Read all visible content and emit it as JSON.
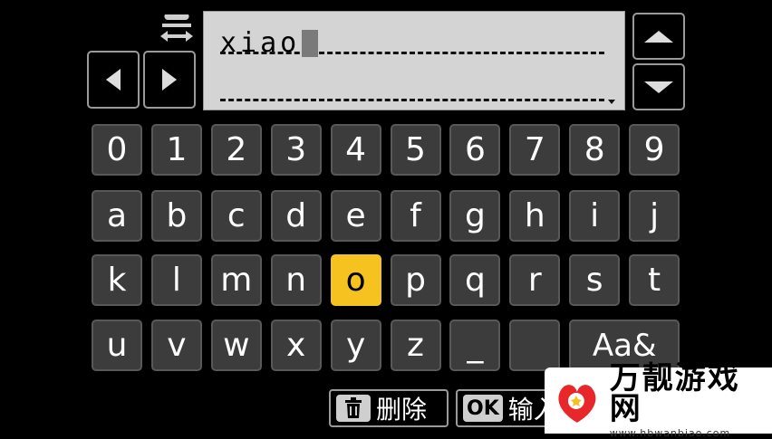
{
  "text_field": {
    "line1": "xiao",
    "line2": ""
  },
  "keyboard": {
    "rows": [
      [
        "0",
        "1",
        "2",
        "3",
        "4",
        "5",
        "6",
        "7",
        "8",
        "9"
      ],
      [
        "a",
        "b",
        "c",
        "d",
        "e",
        "f",
        "g",
        "h",
        "i",
        "j"
      ],
      [
        "k",
        "l",
        "m",
        "n",
        "o",
        "p",
        "q",
        "r",
        "s",
        "t"
      ],
      [
        "u",
        "v",
        "w",
        "x",
        "y",
        "z",
        "_",
        "",
        "Aa&"
      ]
    ],
    "selected_key": "o"
  },
  "hints": {
    "delete_label": "删除",
    "delete_icon_text": "",
    "ok_icon_text": "OK",
    "ok_label": "输入"
  },
  "watermark": {
    "brand": "万靓游戏网",
    "url": "www.hbwanbiao.com"
  },
  "colors": {
    "selected": "#f6c21f",
    "key_bg": "#3c3c3c",
    "field_bg": "#d4d4d4"
  }
}
